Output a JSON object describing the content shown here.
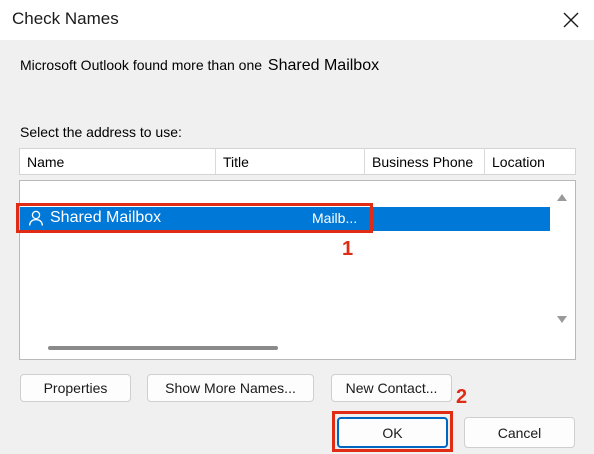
{
  "window": {
    "title": "Check Names"
  },
  "message": {
    "prefix": "Microsoft Outlook found more than one ",
    "name": "Shared Mailbox"
  },
  "list": {
    "label": "Select the address to use:",
    "columns": [
      "Name",
      "Title",
      "Business Phone",
      "Location"
    ],
    "rows": [
      {
        "name": "Shared Mailbox",
        "title": "Mailb...",
        "selected": true
      }
    ]
  },
  "annotations": {
    "step1": "1",
    "step2": "2"
  },
  "buttons": {
    "properties": "Properties",
    "show_more_names": "Show More Names...",
    "new_contact": "New Contact...",
    "ok": "OK",
    "cancel": "Cancel"
  },
  "colors": {
    "selection": "#0078d7",
    "annotation": "#e02c14",
    "default_button_border": "#0067c0"
  },
  "icons": {
    "close": "close-icon",
    "row": "person-icon"
  }
}
